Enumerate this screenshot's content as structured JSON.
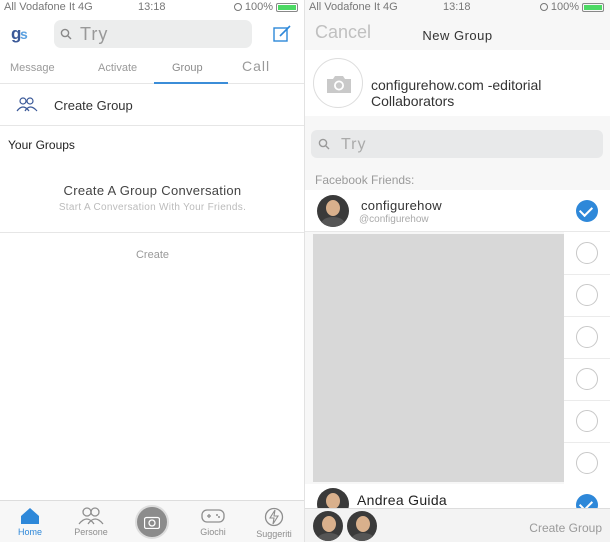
{
  "left": {
    "status": {
      "carrier": "All Vodafone It 4G",
      "time": "13:18",
      "battery": "100%"
    },
    "search": {
      "placeholder": "Try"
    },
    "tabs": [
      {
        "label": "Message"
      },
      {
        "label": "Activate"
      },
      {
        "label": "Group",
        "active": true
      },
      {
        "label": "Call"
      }
    ],
    "create_group_label": "Create Group",
    "your_groups_label": "Your Groups",
    "cta": {
      "title": "Create A Group Conversation",
      "subtitle": "Start A Conversation With Your Friends.",
      "link": "Create"
    },
    "tabbar": [
      {
        "label": "Home",
        "icon": "home-icon",
        "active": true
      },
      {
        "label": "Persone",
        "icon": "people-icon"
      },
      {
        "label": "",
        "icon": "camera-icon"
      },
      {
        "label": "Giochi",
        "icon": "gamepad-icon"
      },
      {
        "label": "Suggeriti",
        "icon": "bolt-icon"
      }
    ]
  },
  "right": {
    "status": {
      "carrier": "All Vodafone It 4G",
      "time": "13:18",
      "battery": "100%"
    },
    "cancel_label": "Cancel",
    "title": "New Group",
    "group_name": "configurehow.com -editorial Collaborators",
    "search": {
      "placeholder": "Try"
    },
    "section_header": "Facebook Friends:",
    "friends": [
      {
        "name": "configurehow",
        "handle": "@configurehow",
        "selected": true
      },
      {
        "name": "",
        "selected": false
      },
      {
        "name": "",
        "selected": false
      },
      {
        "name": "",
        "selected": false
      },
      {
        "name": "",
        "selected": false
      },
      {
        "name": "",
        "selected": false
      },
      {
        "name": "",
        "selected": false
      },
      {
        "name": "Andrea Guida",
        "selected": true
      }
    ],
    "create_group_button": "Create Group"
  },
  "colors": {
    "accent": "#2e88d9",
    "brand": "#3b5998",
    "selected_check": "#2e88d9"
  }
}
